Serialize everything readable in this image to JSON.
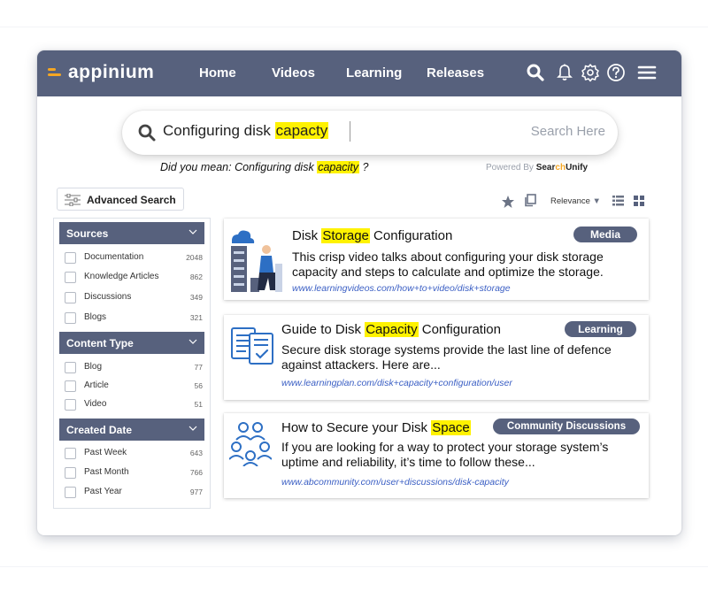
{
  "app": {
    "name": "appinium"
  },
  "nav": {
    "items": [
      "Home",
      "Videos",
      "Learning",
      "Releases"
    ],
    "icons": [
      "search-icon",
      "bell-icon",
      "gear-icon",
      "help-icon",
      "menu-icon"
    ]
  },
  "search": {
    "query_prefix": "Configuring disk ",
    "query_highlight": "capacty",
    "placeholder": "Search Here"
  },
  "suggestion": {
    "prefix": "Did you mean: Configuring disk ",
    "highlight": "capacity",
    "suffix": " ?"
  },
  "powered": {
    "label": "Powered By",
    "brand_a": "Sear",
    "brand_o": "ch",
    "brand_b": "Unify"
  },
  "toolbar": {
    "advanced_search_label": "Advanced Search",
    "sort_label": "Relevance"
  },
  "facets": [
    {
      "title": "Sources",
      "items": [
        {
          "name": "Documentation",
          "count": "2048"
        },
        {
          "name": "Knowledge Articles",
          "count": "862"
        },
        {
          "name": "Discussions",
          "count": "349"
        },
        {
          "name": "Blogs",
          "count": "321"
        }
      ]
    },
    {
      "title": "Content Type",
      "items": [
        {
          "name": "Blog",
          "count": "77"
        },
        {
          "name": "Article",
          "count": "56"
        },
        {
          "name": "Video",
          "count": "51"
        }
      ]
    },
    {
      "title": "Created Date",
      "items": [
        {
          "name": "Past Week",
          "count": "643"
        },
        {
          "name": "Past Month",
          "count": "766"
        },
        {
          "name": "Past Year",
          "count": "977"
        }
      ]
    }
  ],
  "results": [
    {
      "title_pre": "Disk ",
      "title_hl": "Storage",
      "title_post": " Configuration",
      "badge": "Media",
      "desc": "This crisp video talks about configuring your disk storage capacity and steps to calculate and optimize the storage.",
      "url": "www.learningvideos.com/how+to+video/disk+storage"
    },
    {
      "title_pre": "Guide to Disk ",
      "title_hl": "Capacity",
      "title_post": " Configuration",
      "badge": "Learning",
      "desc": "Secure disk storage systems provide the last line of defence against attackers. Here are...",
      "url": "www.learningplan.com/disk+capacity+configuration/user"
    },
    {
      "title_pre": "How to Secure your Disk ",
      "title_hl": "Space",
      "title_post": "",
      "badge": "Community Discussions",
      "desc": "If you are looking for a way to protect your storage system’s uptime and reliability, it’s time to follow these...",
      "url": "www.abcommunity.com/user+discussions/disk-capacity"
    }
  ],
  "colors": {
    "nav": "#57617d",
    "highlight": "#fff200",
    "accent": "#f5a623",
    "link": "#3b5fc4"
  }
}
